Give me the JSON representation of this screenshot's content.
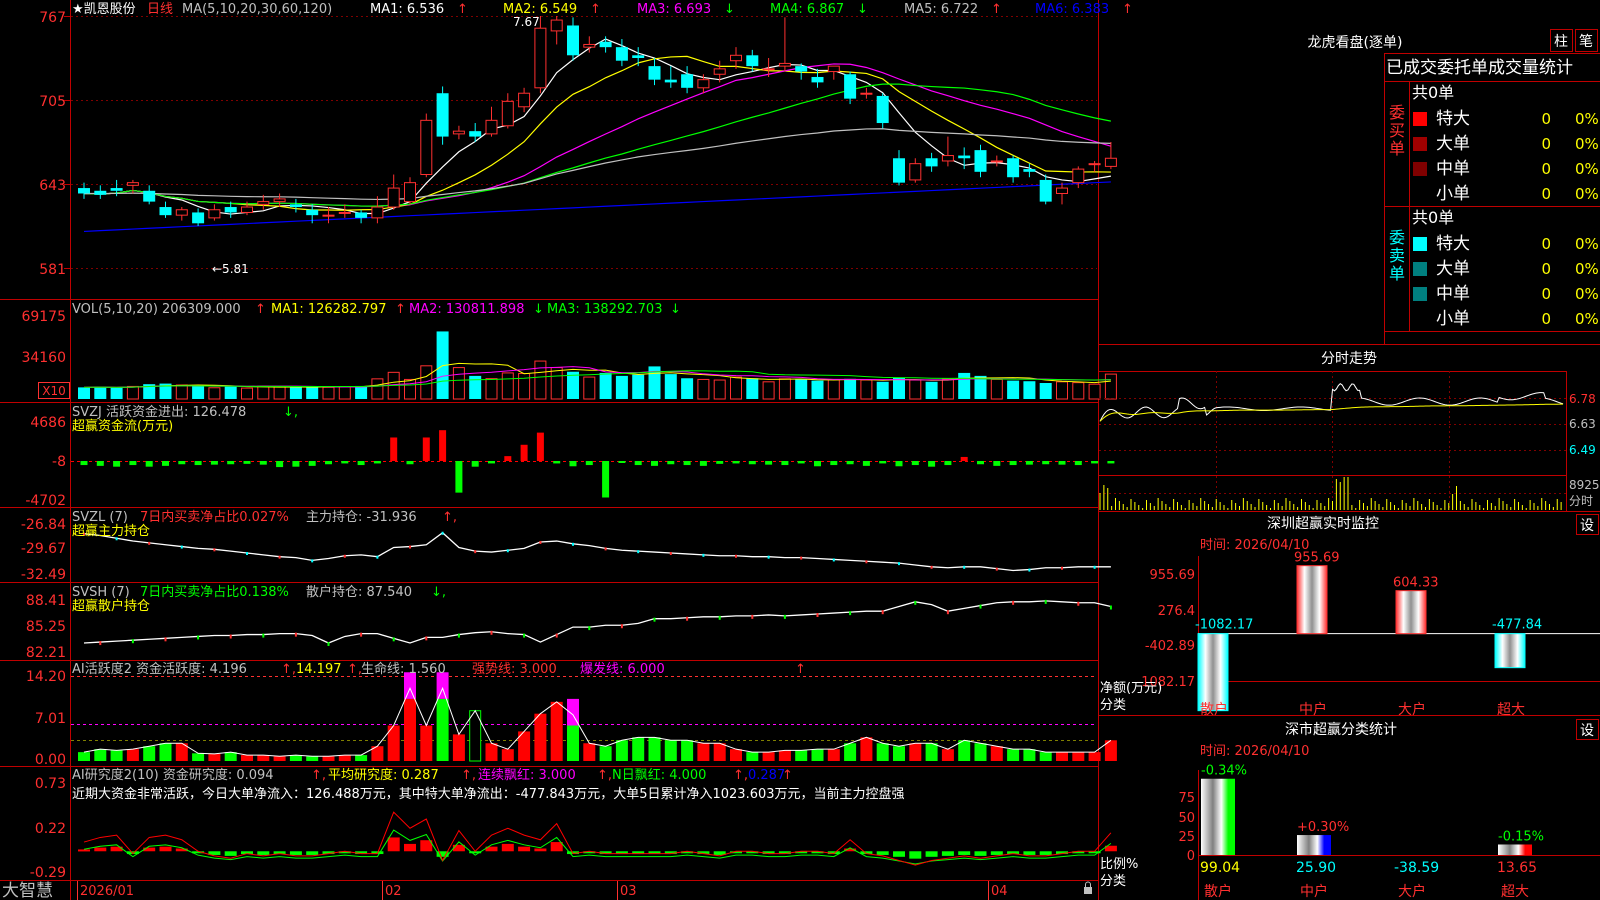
{
  "stock": {
    "name": "★凯恩股份",
    "period": "日线",
    "ma_label": "MA(5,10,20,30,60,120)",
    "ma_values": [
      {
        "label": "MA1: 6.536",
        "arrow": "↑",
        "color": "#ffffff"
      },
      {
        "label": "MA2: 6.549",
        "arrow": "↑",
        "color": "#ffff00"
      },
      {
        "label": "MA3: 6.693",
        "arrow": "↓",
        "color": "#ff00ff"
      },
      {
        "label": "MA4: 6.867",
        "arrow": "↓",
        "color": "#00ff00"
      },
      {
        "label": "MA5: 6.722",
        "arrow": "↑",
        "color": "#c0c0c0"
      },
      {
        "label": "MA6: 6.383",
        "arrow": "↑",
        "color": "#0000ff"
      }
    ],
    "high_mark": "7.67",
    "low_mark": "←5.81",
    "price_ticks": [
      "767",
      "705",
      "643",
      "581"
    ],
    "dates": [
      "2026/01",
      "02",
      "03",
      "04"
    ]
  },
  "vol": {
    "label": "VOL(5,10,20) 206309.000",
    "ma1": "MA1: 126282.797",
    "ma2": "MA2: 130811.898",
    "ma3": "MA3: 138292.703",
    "ticks": [
      "69175",
      "34160"
    ],
    "unit": "X10"
  },
  "svzj": {
    "label": "SVZJ  活跃资金进出: 126.478",
    "sub": "超赢资金流(万元)",
    "ticks": [
      "4686",
      "-8",
      "-4702"
    ]
  },
  "svzl": {
    "label": "SVZL (7)",
    "ratio": "7日内买卖净占比0.027%",
    "hold": "主力持仓: -31.936",
    "sub": "超赢主力持仓",
    "ticks": [
      "-26.84",
      "-29.67",
      "-32.49"
    ]
  },
  "svsh": {
    "label": "SVSH (7)",
    "ratio": "7日内买卖净占比0.138%",
    "hold": "散户持仓: 87.540",
    "sub": "超赢散户持仓",
    "ticks": [
      "88.41",
      "85.25",
      "82.21"
    ]
  },
  "ai1": {
    "label": "AI活跃度2 资金活跃度: 4.196",
    "v2": "14.197",
    "life": "生命线: 1.560",
    "strong": "强势线: 3.000",
    "burst": "爆发线: 6.000",
    "ticks": [
      "14.20",
      "7.01",
      "0.00"
    ]
  },
  "ai2": {
    "label": "AI研究度2(10) 资金研究度: 0.094",
    "avg": "平均研究度: 0.287",
    "cont": "连续飘红: 3.000",
    "nday": "N日飘红: 4.000",
    "last": "0.287",
    "summary": "近期大资金非常活跃，今日大单净流入：126.488万元，其中特大单净流出：-477.843万元，大单5日累计净入1023.603万元，当前主力控盘强",
    "ticks": [
      "0.73",
      "0.22",
      "-0.29"
    ]
  },
  "brand": "大智慧",
  "right": {
    "dragon_title": "龙虎看盘(逐单)",
    "btn_col": "柱",
    "btn_bi": "笔",
    "stat_title": "已成交委托单成交量统计",
    "buy_group": "委买单",
    "sell_group": "委卖单",
    "total": "共0单",
    "rows": [
      "特大",
      "大单",
      "中单",
      "小单"
    ],
    "zero": "0",
    "pct": "0%",
    "buy_colors": [
      "#ff0000",
      "#a00000",
      "#800000",
      "#000000"
    ],
    "sell_colors": [
      "#00ffff",
      "#008080",
      "#008080",
      "#000000"
    ],
    "intraday_title": "分时走势",
    "intraday_ticks": [
      "6.78",
      "6.63",
      "6.49"
    ],
    "intraday_vol": "8925",
    "intraday_unit": "分时",
    "sz_title": "深圳超赢实时监控",
    "sz_btn": "设",
    "sz_time": "时间: 2026/04/10",
    "sz_ticks": [
      "955.69",
      "276.4",
      "-402.89",
      "-1082.17"
    ],
    "sz_yaxis": "净额(万元)",
    "sz_xaxis": "分类",
    "sz_labels": [
      "散户",
      "中户",
      "大户",
      "超大"
    ],
    "sz_values": [
      "-1082.17",
      "955.69",
      "604.33",
      "-477.84"
    ],
    "sc_title": "深市超赢分类统计",
    "sc_btn": "设",
    "sc_time": "时间: 2026/04/10",
    "sc_ticks": [
      "75",
      "50",
      "25",
      "0"
    ],
    "sc_yaxis": "比例%",
    "sc_xaxis": "分类",
    "sc_labels": [
      "散户",
      "中户",
      "大户",
      "超大"
    ],
    "sc_top": [
      "-0.34%",
      "+0.30%",
      "",
      "-0.15%"
    ],
    "sc_bottom": [
      "99.04",
      "25.90",
      "-38.59",
      "13.65"
    ]
  },
  "chart_data": [
    {
      "type": "candlestick",
      "title": "凯恩股份 日线",
      "ylim": [
        5.81,
        7.67
      ],
      "x_ticks": [
        "2026/01",
        "02",
        "03",
        "04"
      ],
      "ohlc": [
        [
          6.4,
          6.36,
          6.44,
          6.32
        ],
        [
          6.38,
          6.35,
          6.42,
          6.32
        ],
        [
          6.4,
          6.38,
          6.46,
          6.34
        ],
        [
          6.42,
          6.44,
          6.46,
          6.36
        ],
        [
          6.38,
          6.3,
          6.42,
          6.28
        ],
        [
          6.26,
          6.2,
          6.3,
          6.18
        ],
        [
          6.2,
          6.24,
          6.26,
          6.16
        ],
        [
          6.22,
          6.14,
          6.25,
          6.12
        ],
        [
          6.18,
          6.24,
          6.28,
          6.16
        ],
        [
          6.26,
          6.22,
          6.3,
          6.18
        ],
        [
          6.22,
          6.26,
          6.3,
          6.2
        ],
        [
          6.28,
          6.3,
          6.35,
          6.24
        ],
        [
          6.3,
          6.32,
          6.36,
          6.26
        ],
        [
          6.28,
          6.26,
          6.32,
          6.22
        ],
        [
          6.24,
          6.2,
          6.28,
          6.14
        ],
        [
          6.2,
          6.2,
          6.26,
          6.14
        ],
        [
          6.22,
          6.22,
          6.28,
          6.18
        ],
        [
          6.22,
          6.18,
          6.24,
          6.14
        ],
        [
          6.18,
          6.26,
          6.34,
          6.14
        ],
        [
          6.26,
          6.4,
          6.5,
          6.24
        ],
        [
          6.3,
          6.44,
          6.48,
          6.28
        ],
        [
          6.5,
          6.9,
          6.95,
          6.48
        ],
        [
          7.1,
          6.78,
          7.15,
          6.72
        ],
        [
          6.8,
          6.82,
          6.86,
          6.76
        ],
        [
          6.82,
          6.78,
          6.88,
          6.74
        ],
        [
          6.8,
          6.9,
          7.0,
          6.78
        ],
        [
          6.86,
          7.04,
          7.1,
          6.84
        ],
        [
          7.0,
          7.1,
          7.14,
          6.96
        ],
        [
          7.14,
          7.58,
          7.67,
          7.1
        ],
        [
          7.56,
          7.64,
          7.67,
          7.46
        ],
        [
          7.6,
          7.38,
          7.66,
          7.34
        ],
        [
          7.44,
          7.46,
          7.52,
          7.4
        ],
        [
          7.48,
          7.44,
          7.52,
          7.4
        ],
        [
          7.44,
          7.34,
          7.5,
          7.3
        ],
        [
          7.38,
          7.36,
          7.44,
          7.3
        ],
        [
          7.3,
          7.2,
          7.36,
          7.16
        ],
        [
          7.2,
          7.18,
          7.3,
          7.14
        ],
        [
          7.24,
          7.14,
          7.3,
          7.1
        ],
        [
          7.14,
          7.2,
          7.24,
          7.1
        ],
        [
          7.24,
          7.28,
          7.34,
          7.18
        ],
        [
          7.34,
          7.38,
          7.44,
          7.28
        ],
        [
          7.38,
          7.3,
          7.42,
          7.26
        ],
        [
          7.28,
          7.28,
          7.36,
          7.22
        ],
        [
          7.3,
          7.32,
          7.66,
          7.26
        ],
        [
          7.3,
          7.26,
          7.32,
          7.2
        ],
        [
          7.22,
          7.18,
          7.28,
          7.14
        ],
        [
          7.26,
          7.3,
          7.3,
          7.2
        ],
        [
          7.24,
          7.06,
          7.26,
          7.02
        ],
        [
          7.1,
          7.1,
          7.14,
          7.06
        ],
        [
          7.08,
          6.88,
          7.1,
          6.84
        ],
        [
          6.62,
          6.44,
          6.68,
          6.42
        ],
        [
          6.46,
          6.58,
          6.62,
          6.44
        ],
        [
          6.62,
          6.56,
          6.66,
          6.52
        ],
        [
          6.6,
          6.64,
          6.78,
          6.56
        ],
        [
          6.64,
          6.62,
          6.7,
          6.54
        ],
        [
          6.68,
          6.52,
          6.72,
          6.48
        ],
        [
          6.6,
          6.6,
          6.64,
          6.56
        ],
        [
          6.62,
          6.48,
          6.64,
          6.44
        ],
        [
          6.54,
          6.52,
          6.58,
          6.48
        ],
        [
          6.46,
          6.3,
          6.5,
          6.28
        ],
        [
          6.36,
          6.4,
          6.44,
          6.28
        ],
        [
          6.44,
          6.54,
          6.56,
          6.4
        ],
        [
          6.58,
          6.58,
          6.6,
          6.52
        ],
        [
          6.56,
          6.62,
          6.74,
          6.54
        ]
      ]
    },
    {
      "type": "bar",
      "title": "VOL(5,10,20)",
      "ylim": [
        0,
        69175
      ],
      "values": [
        9800,
        10200,
        9500,
        10600,
        12500,
        13000,
        11800,
        11000,
        9500,
        10500,
        9200,
        10800,
        10100,
        9800,
        10300,
        9900,
        10500,
        11000,
        17000,
        22500,
        16500,
        28000,
        57000,
        26500,
        19500,
        17200,
        22000,
        21500,
        32000,
        26500,
        23000,
        18500,
        22000,
        19500,
        20500,
        27500,
        21000,
        17500,
        16500,
        16000,
        18500,
        17500,
        14500,
        17000,
        16800,
        15500,
        16200,
        17000,
        16000,
        14500,
        18000,
        16000,
        14500,
        16800,
        22000,
        19500,
        16500,
        15500,
        15000,
        13500,
        14500,
        13800,
        12500,
        21000
      ]
    },
    {
      "type": "bar",
      "title": "SVZJ 活跃资金进出",
      "ylim": [
        -4702,
        4686
      ],
      "values": [
        -500,
        -600,
        -700,
        -500,
        -700,
        -600,
        -400,
        -500,
        -450,
        -400,
        -350,
        -450,
        -750,
        -700,
        -600,
        -400,
        -300,
        -500,
        -300,
        2900,
        -400,
        2900,
        3800,
        -3900,
        -700,
        -300,
        600,
        2000,
        3500,
        -300,
        -650,
        -500,
        -4500,
        -200,
        -500,
        -600,
        -400,
        -500,
        -600,
        -350,
        -300,
        -400,
        -450,
        -500,
        -300,
        -650,
        -500,
        -400,
        -600,
        -300,
        -650,
        -500,
        -700,
        -500,
        500,
        -400,
        -600,
        -500,
        -450,
        -400,
        -450,
        -500,
        -300,
        -300
      ]
    },
    {
      "type": "line",
      "title": "SVZL 主力持仓",
      "ylim": [
        -32.49,
        -26.84
      ],
      "values": [
        -28.0,
        -28.2,
        -28.5,
        -28.8,
        -29.0,
        -29.2,
        -29.4,
        -29.6,
        -29.7,
        -29.9,
        -30.1,
        -30.3,
        -30.5,
        -30.6,
        -30.9,
        -30.7,
        -30.4,
        -30.3,
        -30.5,
        -29.5,
        -29.4,
        -29.2,
        -27.9,
        -29.5,
        -29.9,
        -30.0,
        -29.8,
        -29.6,
        -28.9,
        -28.8,
        -29.1,
        -29.3,
        -29.6,
        -29.8,
        -29.9,
        -30.0,
        -30.1,
        -30.2,
        -30.3,
        -30.4,
        -30.4,
        -30.5,
        -30.5,
        -30.6,
        -30.6,
        -30.7,
        -30.8,
        -30.9,
        -31.0,
        -31.1,
        -31.2,
        -31.4,
        -31.6,
        -31.7,
        -31.6,
        -31.6,
        -31.8,
        -32.0,
        -31.9,
        -31.7,
        -31.7,
        -31.6,
        -31.6,
        -31.6
      ]
    },
    {
      "type": "line",
      "title": "SVSH 散户持仓",
      "ylim": [
        82.21,
        88.41
      ],
      "values": [
        83.6,
        83.7,
        83.8,
        83.9,
        84.0,
        84.1,
        84.2,
        84.3,
        84.4,
        84.4,
        84.5,
        84.5,
        84.6,
        84.6,
        84.4,
        83.6,
        84.3,
        84.6,
        84.6,
        84.1,
        83.6,
        84.2,
        84.2,
        84.5,
        84.7,
        84.8,
        84.6,
        84.5,
        83.7,
        84.5,
        85.3,
        85.3,
        85.5,
        85.5,
        85.7,
        86.2,
        86.2,
        86.3,
        86.4,
        86.4,
        86.5,
        86.5,
        86.6,
        86.5,
        86.6,
        86.7,
        86.8,
        86.9,
        87.0,
        87.0,
        87.5,
        88.0,
        87.7,
        87.0,
        87.3,
        87.6,
        87.9,
        88.0,
        88.0,
        88.1,
        88.0,
        87.9,
        87.9,
        87.5
      ]
    },
    {
      "type": "bar",
      "title": "AI活跃度2 资金活跃度",
      "ylim": [
        0,
        14.2
      ],
      "values": [
        1.5,
        2.0,
        1.8,
        2.0,
        2.5,
        3.0,
        3.0,
        1.3,
        1.2,
        1.5,
        1.0,
        1.0,
        0.8,
        1.0,
        0.8,
        0.8,
        1.0,
        1.0,
        2.5,
        6.0,
        10.5,
        6.0,
        10.5,
        4.5,
        8.5,
        3.0,
        2.0,
        5.0,
        8.0,
        10.0,
        6.0,
        3.0,
        2.5,
        3.5,
        4.0,
        4.0,
        3.5,
        3.5,
        3.0,
        3.0,
        2.0,
        1.5,
        1.5,
        1.8,
        1.8,
        2.0,
        2.0,
        3.0,
        4.0,
        3.0,
        2.5,
        3.0,
        3.0,
        2.0,
        3.5,
        3.0,
        2.5,
        2.0,
        2.0,
        1.5,
        1.5,
        1.5,
        1.5,
        3.5
      ],
      "overflow": [
        0,
        0,
        0,
        0,
        0,
        0,
        0,
        0,
        0,
        0,
        0,
        0,
        0,
        0,
        0,
        0,
        0,
        0,
        0,
        0,
        4.5,
        0,
        4.5,
        0,
        0,
        0,
        0,
        0,
        0,
        0,
        4.5,
        0,
        0,
        0,
        0,
        0,
        0,
        0,
        0,
        0,
        0,
        0,
        0,
        0,
        0,
        0,
        0,
        0,
        0,
        0,
        0,
        0,
        0,
        0,
        0,
        0,
        0,
        0,
        0,
        0,
        0,
        0,
        0,
        0
      ]
    },
    {
      "type": "bar",
      "title": "AI研究度2 资金研究度",
      "ylim": [
        -0.29,
        0.73
      ],
      "values": [
        0.02,
        0.04,
        0.05,
        -0.03,
        0.04,
        0.05,
        0.03,
        -0.02,
        -0.04,
        -0.05,
        -0.03,
        -0.04,
        -0.03,
        -0.04,
        -0.04,
        -0.03,
        -0.02,
        -0.03,
        -0.03,
        0.15,
        0.08,
        0.12,
        -0.06,
        0.07,
        -0.02,
        0.05,
        0.08,
        0.05,
        0.03,
        0.1,
        -0.03,
        -0.02,
        -0.03,
        -0.03,
        -0.03,
        -0.03,
        -0.03,
        -0.02,
        -0.03,
        -0.04,
        -0.02,
        -0.02,
        -0.03,
        -0.03,
        -0.02,
        -0.02,
        -0.03,
        0.03,
        -0.03,
        -0.04,
        -0.06,
        -0.08,
        -0.06,
        -0.05,
        -0.04,
        -0.05,
        -0.04,
        -0.03,
        -0.04,
        -0.04,
        -0.03,
        -0.02,
        -0.02,
        0.06
      ]
    },
    {
      "type": "bar",
      "title": "深圳超赢实时监控",
      "categories": [
        "散户",
        "中户",
        "大户",
        "超大"
      ],
      "values": [
        -1082.17,
        955.69,
        604.33,
        -477.84
      ],
      "ylim": [
        -1082.17,
        955.69
      ]
    },
    {
      "type": "bar",
      "title": "深市超赢分类统计",
      "categories": [
        "散户",
        "中户",
        "大户",
        "超大"
      ],
      "values": [
        99.04,
        25.9,
        -38.59,
        13.65
      ],
      "ylim": [
        0,
        100
      ]
    }
  ]
}
